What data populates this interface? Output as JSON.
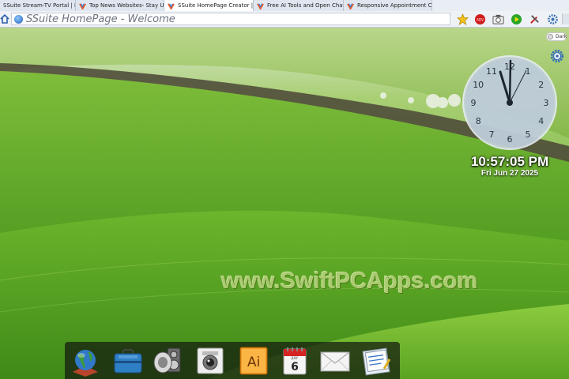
{
  "tabs": [
    {
      "label": "SSuite Stream-TV Portal | Ho",
      "active": false
    },
    {
      "label": "Top News Websites- Stay Upd",
      "active": false
    },
    {
      "label": "SSuite HomePage Creator | Cr",
      "active": true
    },
    {
      "label": "Free AI Tools and Open Chat P",
      "active": false
    },
    {
      "label": "Responsive Appointment Cale",
      "active": false
    }
  ],
  "address": {
    "text": "SSuite HomePage - Welcome"
  },
  "toolbar": {
    "icons": [
      "star-icon",
      "adblock-icon",
      "screenshot-icon",
      "play-icon",
      "tools-icon",
      "settings-icon"
    ],
    "adblock_label": "ADV"
  },
  "desktop": {
    "dark_toggle_label": "Dark",
    "clock": {
      "numbers": [
        "12",
        "1",
        "2",
        "3",
        "4",
        "5",
        "6",
        "7",
        "8",
        "9",
        "10",
        "11"
      ]
    },
    "time": "10:57:05 PM",
    "date": "Fri Jun 27 2025",
    "watermark": "www.SwiftPCApps.com",
    "calendar": {
      "month": "JULY",
      "day": "6"
    },
    "ai_label": "Ai"
  },
  "dock": {
    "items": [
      "globe-icon",
      "briefcase-icon",
      "speaker-icon",
      "camera-icon",
      "illustrator-icon",
      "calendar-icon",
      "mail-icon",
      "notes-icon"
    ]
  },
  "colors": {
    "accent": "#1f5fb3",
    "grass": "#6fb23a"
  }
}
